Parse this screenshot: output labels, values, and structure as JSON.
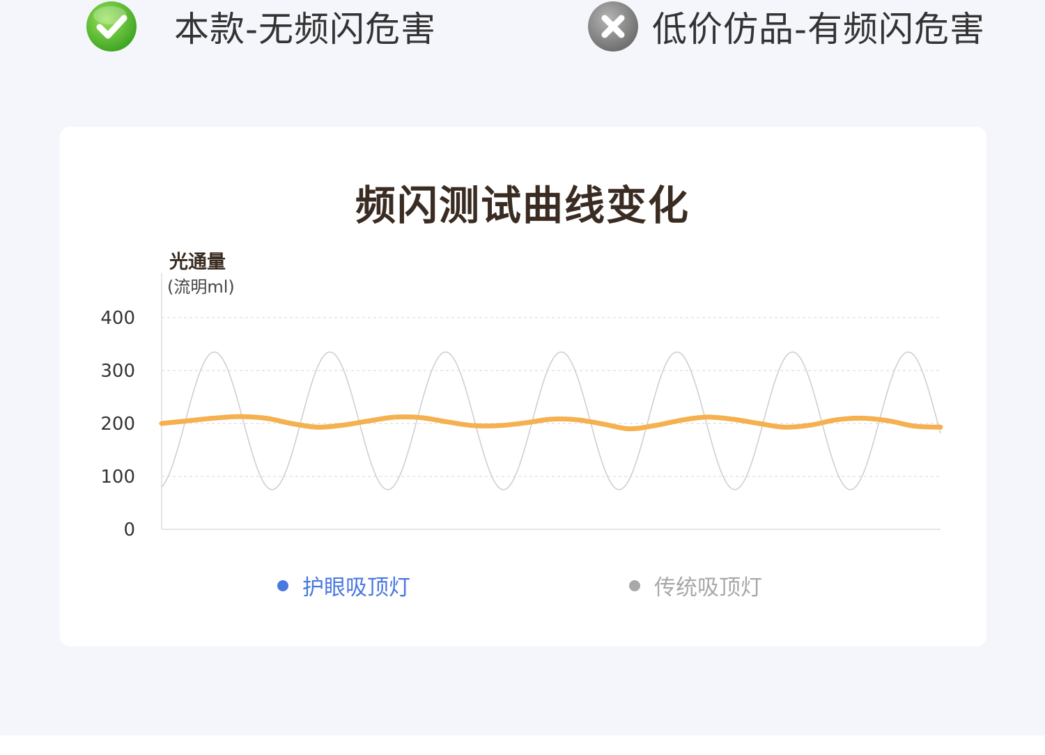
{
  "header": {
    "good_label": "本款-无频闪危害",
    "bad_label": "低价仿品-有频闪危害",
    "good_icon": "check-circle-icon",
    "bad_icon": "x-circle-icon",
    "good_color": "#4cb82d",
    "bad_color": "#8a8a8a"
  },
  "chart_data": {
    "type": "line",
    "title": "频闪测试曲线变化",
    "ylabel": "光通量",
    "yunit": "(流明ml)",
    "ylim": [
      0,
      400
    ],
    "yticks": [
      "0",
      "100",
      "200",
      "300",
      "400"
    ],
    "grid": "dashed horizontal",
    "legend_position": "bottom",
    "series": [
      {
        "name": "护眼吸顶灯",
        "color": "#f5b04f",
        "legend_color": "#4a78e0",
        "values": [
          200,
          205,
          210,
          213,
          210,
          200,
          193,
          197,
          205,
          212,
          211,
          203,
          196,
          196,
          201,
          208,
          207,
          199,
          190,
          196,
          206,
          212,
          208,
          200,
          193,
          197,
          207,
          210,
          205,
          195,
          193
        ]
      },
      {
        "name": "传统吸顶灯",
        "color": "#cfcfcf",
        "legend_color": "#a8a8a8",
        "wave": {
          "period_x": 166,
          "min": 75,
          "max": 335,
          "start_value": 80,
          "start_rising": true
        },
        "sample_values": [
          80,
          335,
          75,
          335,
          75,
          335,
          75,
          335,
          75,
          335,
          75,
          335,
          75,
          335,
          270
        ]
      }
    ]
  }
}
